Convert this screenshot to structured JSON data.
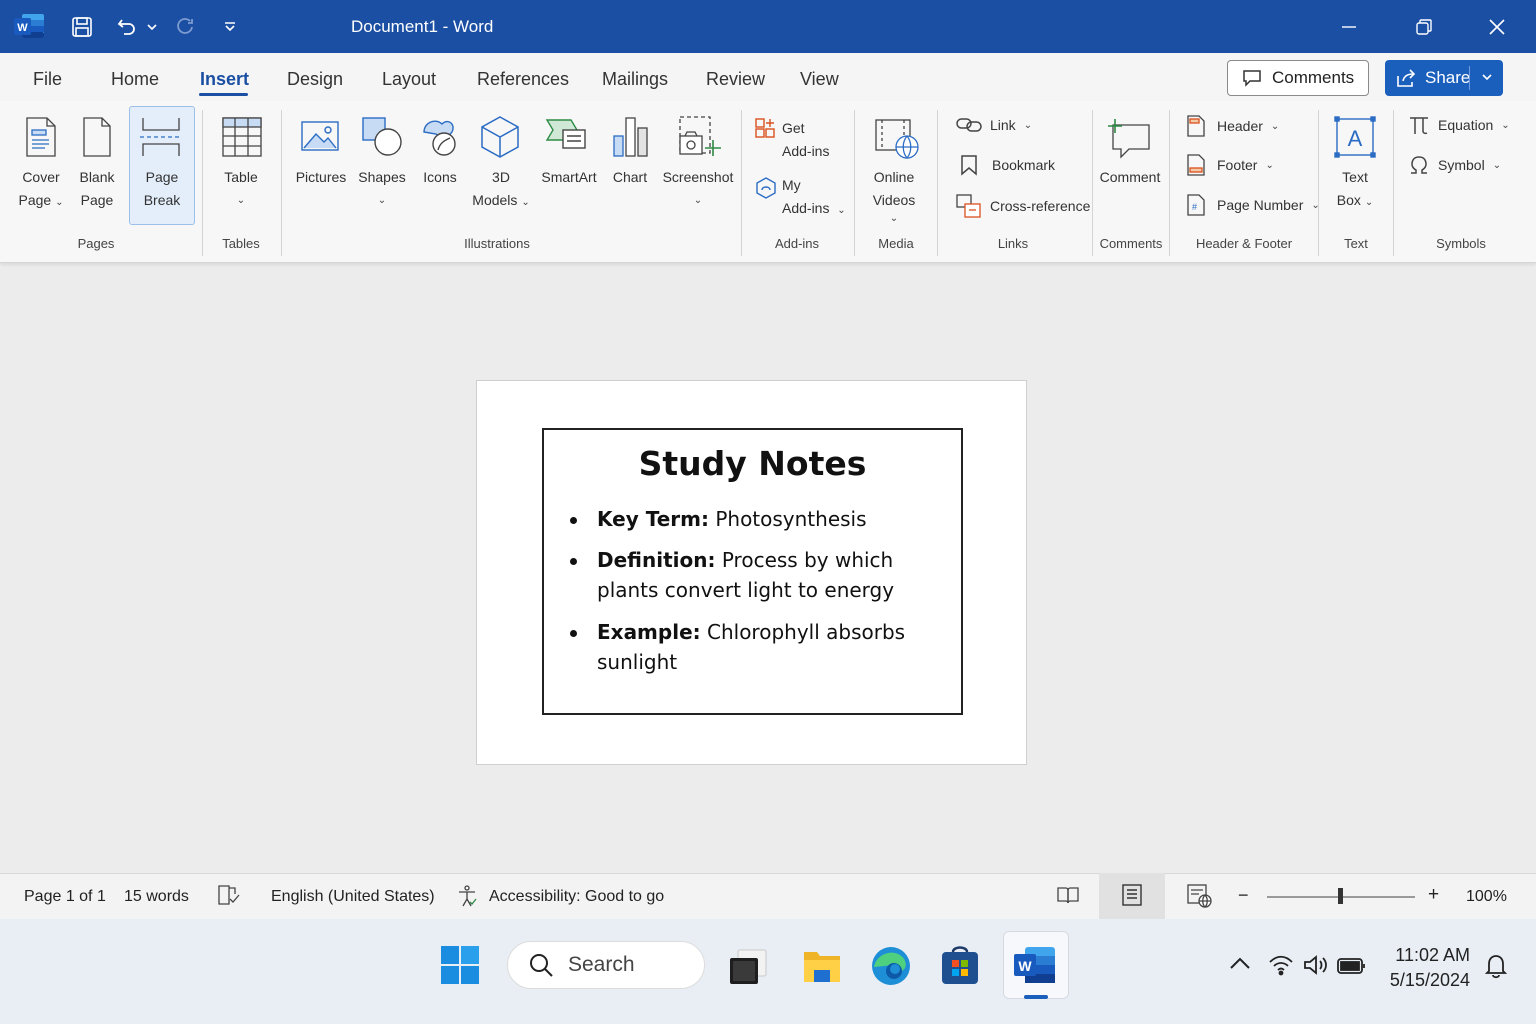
{
  "app": {
    "title": "Document1 - Word",
    "doc_name": "Document1",
    "app_name": "Word",
    "accent": "#1b4fa3"
  },
  "quick_access": {
    "icons": [
      "word-logo-icon",
      "save-icon",
      "undo-icon",
      "undo-dropdown-icon",
      "redo-icon",
      "customize-qat-icon"
    ]
  },
  "window_controls": [
    "minimize-icon",
    "restore-icon",
    "close-icon"
  ],
  "tabs": [
    {
      "label": "File"
    },
    {
      "label": "Home"
    },
    {
      "label": "Insert",
      "active": true
    },
    {
      "label": "Design"
    },
    {
      "label": "Layout"
    },
    {
      "label": "References"
    },
    {
      "label": "Mailings"
    },
    {
      "label": "Review"
    },
    {
      "label": "View"
    }
  ],
  "header_buttons": {
    "comments": "Comments",
    "share": "Share"
  },
  "ribbon": {
    "pages": {
      "label": "Pages",
      "cover_page": [
        "Cover",
        "Page"
      ],
      "blank_page": [
        "Blank",
        "Page"
      ],
      "page_break": [
        "Page",
        "Break"
      ]
    },
    "tables": {
      "label": "Tables",
      "table": "Table"
    },
    "illustrations": {
      "label": "Illustrations",
      "pictures": "Pictures",
      "shapes": "Shapes",
      "icons": "Icons",
      "models": [
        "3D",
        "Models"
      ],
      "smartart": "SmartArt",
      "chart": "Chart",
      "screenshot": "Screenshot"
    },
    "addins": {
      "label": "Add-ins",
      "get": [
        "Get",
        "Add-ins"
      ],
      "my": [
        "My",
        "Add-ins"
      ]
    },
    "media": {
      "label": "Media",
      "online_videos": [
        "Online",
        "Videos"
      ]
    },
    "links": {
      "label": "Links",
      "link": "Link",
      "bookmark": "Bookmark",
      "cross_reference": "Cross-reference"
    },
    "comments": {
      "label": "Comments",
      "comment": "Comment"
    },
    "header_footer": {
      "label": "Header & Footer",
      "header": "Header",
      "footer": "Footer",
      "page_number": "Page Number"
    },
    "text": {
      "label": "Text",
      "text_box": [
        "Text",
        "Box"
      ]
    },
    "symbols": {
      "label": "Symbols",
      "equation": "Equation",
      "symbol": "Symbol"
    }
  },
  "document": {
    "title": "Study Notes",
    "bullets": [
      {
        "term": "Key Term:",
        "text": " Photosynthesis"
      },
      {
        "term": "Definition:",
        "text": " Process by which plants convert light to energy"
      },
      {
        "term": "Example:",
        "text": " Chlorophyll absorbs sunlight"
      }
    ]
  },
  "status_bar": {
    "page": "Page 1 of 1",
    "words": "15 words",
    "language": "English (United States)",
    "accessibility": "Accessibility: Good to go",
    "zoom": "100%",
    "zoom_value": 1.0
  },
  "taskbar": {
    "search_placeholder": "Search",
    "time": "11:02 AM",
    "date": "5/15/2024",
    "apps": [
      "start-icon",
      "task-view-icon",
      "file-explorer-icon",
      "edge-icon",
      "store-icon",
      "word-taskbar-icon"
    ],
    "tray": [
      "chevron-up-icon",
      "wifi-icon",
      "volume-icon",
      "battery-icon",
      "notification-bell-icon"
    ]
  }
}
